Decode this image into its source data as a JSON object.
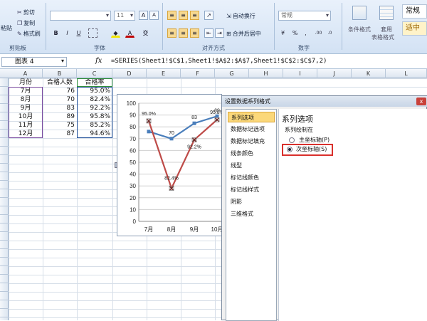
{
  "ribbon": {
    "clipboard": {
      "paste": "粘贴",
      "cut": "剪切",
      "copy": "复制",
      "format_painter": "格式刷",
      "label": "剪贴板"
    },
    "font": {
      "size": "11",
      "bold": "B",
      "italic": "I",
      "underline": "U",
      "grow": "A",
      "shrink": "A",
      "font_color": "A",
      "wen": "变",
      "label": "字体"
    },
    "alignment": {
      "wrap": "自动换行",
      "merge": "合并后居中",
      "label": "对齐方式"
    },
    "number": {
      "format": "常规",
      "percent": "%",
      "comma": ",",
      "label": "数字"
    },
    "styles": {
      "conditional": "条件格式",
      "table_format": "套用",
      "table_format2": "表格格式",
      "normal": "常规",
      "moderate": "适中"
    }
  },
  "formula_bar": {
    "name_box": "图表 4",
    "fx": "fx",
    "formula": "=SERIES(Sheet1!$C$1,Sheet1!$A$2:$A$7,Sheet1!$C$2:$C$7,2)"
  },
  "columns": [
    "A",
    "B",
    "C",
    "D",
    "E",
    "F",
    "G",
    "H",
    "I",
    "J",
    "K",
    "L"
  ],
  "table": {
    "headers": [
      "月份",
      "合格人数",
      "合格率"
    ],
    "rows": [
      [
        "7月",
        "76",
        "95.0%"
      ],
      [
        "8月",
        "70",
        "82.4%"
      ],
      [
        "9月",
        "83",
        "92.2%"
      ],
      [
        "10月",
        "89",
        "95.8%"
      ],
      [
        "11月",
        "75",
        "85.2%"
      ],
      [
        "12月",
        "87",
        "94.6%"
      ]
    ]
  },
  "chart_data": {
    "type": "line",
    "categories": [
      "7月",
      "8月",
      "9月",
      "10月"
    ],
    "series": [
      {
        "values": [
          76,
          70,
          83,
          89
        ],
        "labels": [
          "",
          "70",
          "83",
          "89"
        ],
        "color": "#4a7ebb"
      },
      {
        "values": [
          95.0,
          82.4,
          92.2,
          95.8
        ],
        "labels": [
          "95.0%",
          "82.4%",
          "92.2%",
          "95.8%"
        ],
        "color": "#be4b48"
      }
    ],
    "ylim": [
      0,
      100
    ],
    "yticks": [
      "100",
      "90",
      "80",
      "70",
      "60",
      "50",
      "40",
      "30",
      "20",
      "10",
      "0"
    ],
    "grid": true
  },
  "dialog": {
    "title": "设置数据系列格式",
    "close": "x",
    "items": [
      "系列选项",
      "数据标记选项",
      "数据标记填充",
      "线条颜色",
      "线型",
      "标记线颜色",
      "标记线样式",
      "阴影",
      "三维格式"
    ],
    "section_title": "系列选项",
    "plot_on": "系列绘制在",
    "primary_axis": "主坐标轴(P)",
    "secondary_axis": "次坐标轴(S)",
    "highlight_color": "#d9302c"
  }
}
